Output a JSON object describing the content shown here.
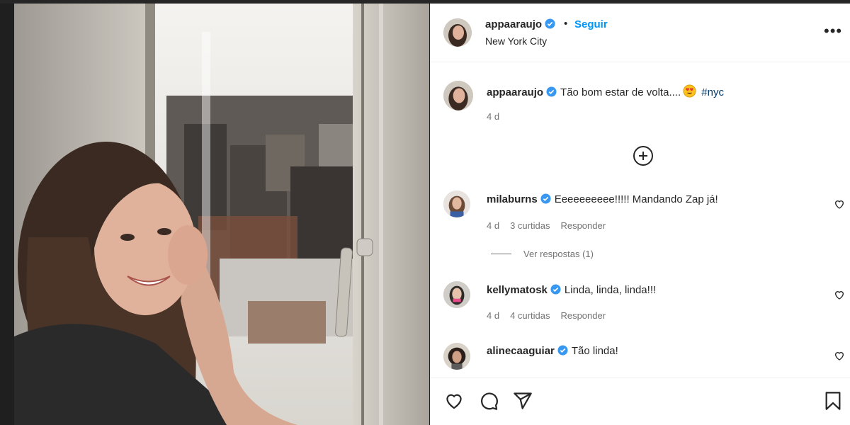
{
  "post": {
    "author": "appaaraujo",
    "follow_label": "Seguir",
    "separator": "•",
    "location": "New York City",
    "more_label": "•••"
  },
  "caption": {
    "username": "appaaraujo",
    "text": "Tão bom estar de volta....",
    "hashtag": "#nyc",
    "age": "4 d"
  },
  "comments": [
    {
      "username": "milaburns",
      "text": "Eeeeeeeeee!!!!! Mandando Zap já!",
      "age": "4 d",
      "likes": "3 curtidas",
      "reply_label": "Responder",
      "view_replies": "Ver respostas (1)"
    },
    {
      "username": "kellymatosk",
      "text": "Linda, linda, linda!!!",
      "age": "4 d",
      "likes": "4 curtidas",
      "reply_label": "Responder"
    },
    {
      "username": "alinecaaguiar",
      "text": "Tão linda!"
    }
  ],
  "colors": {
    "link_blue": "#0095f6",
    "hashtag": "#00376b",
    "meta_gray": "#737373",
    "verified_blue": "#3897f0"
  },
  "icons": [
    "verified-badge-icon",
    "more-options-icon",
    "add-comment-icon",
    "heart-icon",
    "like-icon",
    "comment-icon",
    "share-icon",
    "save-icon",
    "heart-eyes-emoji"
  ]
}
